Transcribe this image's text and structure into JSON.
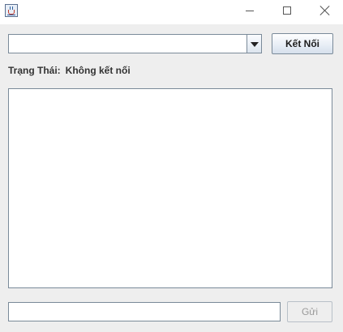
{
  "window": {
    "title": "",
    "icon": "java-coffee-cup-icon",
    "controls": [
      "minimize-icon",
      "maximize-icon",
      "close-icon"
    ]
  },
  "connection": {
    "server_select_value": "",
    "connect_label": "Kết Nối"
  },
  "status": {
    "label": "Trạng Thái:",
    "value": "Không kết nối"
  },
  "chat": {
    "log_text": "",
    "message_value": "",
    "send_label": "Gửi",
    "send_enabled": false
  },
  "colors": {
    "window_bg": "#eeeeee",
    "border": "#7a8a99",
    "disabled_text": "#9a9a9a"
  }
}
